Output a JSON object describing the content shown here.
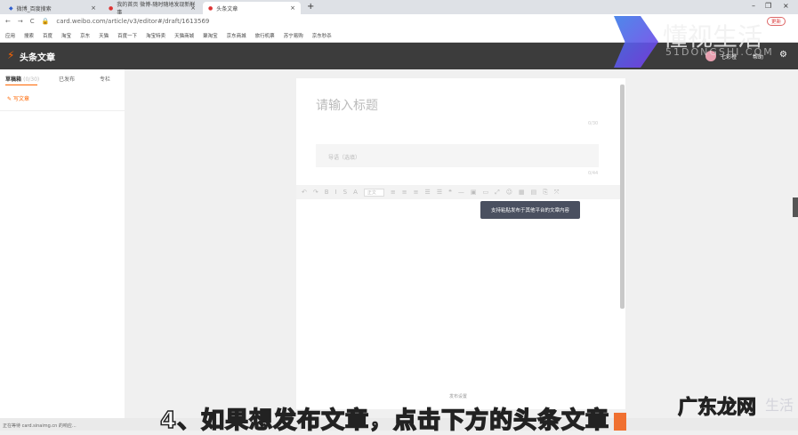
{
  "browser": {
    "tabs": [
      {
        "title": "微博_百度搜索"
      },
      {
        "title": "我的首页 微博-随时随地发现新鲜事"
      },
      {
        "title": "头条文章"
      }
    ],
    "url": "card.weibo.com/article/v3/editor#/draft/1613569",
    "bookmarks": [
      "应用",
      "搜索",
      "百度",
      "淘宝",
      "京东",
      "天猫",
      "百度一下",
      "淘宝特卖",
      "天猫商城",
      "聚淘宝",
      "京东商城",
      "旅行机票",
      "苏宁易购",
      "京东秒杀"
    ],
    "update_label": "更新"
  },
  "header": {
    "title": "头条文章",
    "user": "七彩橙",
    "help": "帮助"
  },
  "sidebar": {
    "tabs": [
      {
        "label": "草稿箱",
        "count": "(0/30)"
      },
      {
        "label": "已发布"
      },
      {
        "label": "专栏"
      }
    ],
    "write": "写文章"
  },
  "editor": {
    "title_placeholder": "请输入标题",
    "title_count": "0/30",
    "summary_placeholder": "导语（选填）",
    "summary_count": "0/44",
    "font_select": "正文",
    "tooltip": "支持粘贴发布于其他平台的文章内容",
    "publish_settings": "发布设置"
  },
  "status": "正在等待 card.sinaimg.cn 的响应...",
  "caption": "4、如果想发布文章，点击下方的头条文章",
  "watermarks": {
    "top": "懂视生活",
    "top_sub": "51DONGSHI.COM",
    "bottom": "广东龙网",
    "bottom_sub": "生活"
  }
}
